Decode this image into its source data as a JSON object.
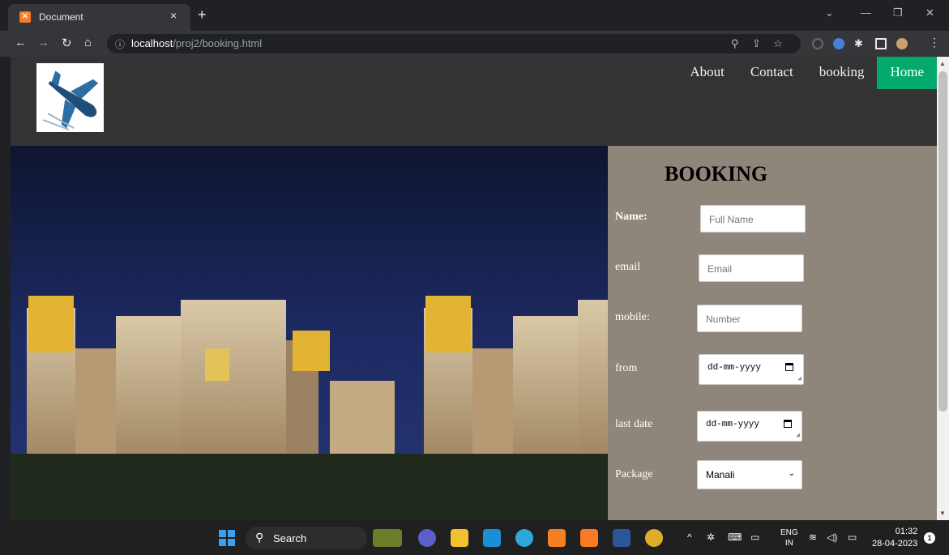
{
  "browser": {
    "tab_title": "Document",
    "tab_close": "×",
    "new_tab": "+",
    "url_host": "localhost",
    "url_path": "/proj2/booking.html"
  },
  "site": {
    "nav": [
      "About",
      "Contact",
      "booking",
      "Home"
    ],
    "active_nav": "Home"
  },
  "booking_form": {
    "title": "BOOKING",
    "fields": [
      {
        "label": "Name:",
        "placeholder": "Full Name"
      },
      {
        "label": "email",
        "placeholder": "Email"
      },
      {
        "label": "mobile:",
        "placeholder": "Number"
      },
      {
        "label": "from",
        "value": "dd-mm-yyyy"
      },
      {
        "label": "last date",
        "value": "dd-mm-yyyy"
      },
      {
        "label": "Package",
        "value": "Manali"
      }
    ]
  },
  "taskbar": {
    "search_label": "Search",
    "lang_top": "ENG",
    "lang_bottom": "IN",
    "time": "01:32",
    "date": "28-04-2023",
    "notification_count": "1"
  },
  "colors": {
    "nav_active": "#04aa6d",
    "form_panel": "#8f867b",
    "header_bg": "#333333"
  }
}
